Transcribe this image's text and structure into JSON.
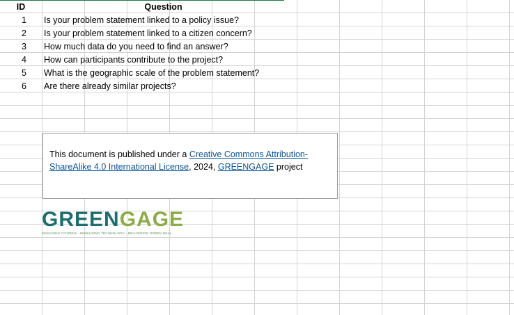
{
  "table": {
    "headers": {
      "id": "ID",
      "question": "Question"
    },
    "rows": [
      {
        "id": "1",
        "question": "Is your problem statement linked to a policy issue?"
      },
      {
        "id": "2",
        "question": "Is your problem statement linked to a citizen concern?"
      },
      {
        "id": "3",
        "question": "How much data do you need to find an answer?"
      },
      {
        "id": "4",
        "question": "How can participants contribute to the project?"
      },
      {
        "id": "5",
        "question": "What is the geographic scale of the problem statement?"
      },
      {
        "id": "6",
        "question": "Are there already similar projects?"
      }
    ]
  },
  "license": {
    "prefix": "This document is published under a ",
    "license_link": "Creative Commons Attribution-ShareAlike 4.0 International License",
    "middle": ", 2024, ",
    "project_link": "GREENGAGE",
    "suffix": " project"
  },
  "logo": {
    "word_part1": "GREEN",
    "word_part2": "GAGE",
    "tagline": "ENGAGING CITIZENS - MOBILIZING TECHNOLOGY - DELIVERING GREEN DEAL",
    "colors": {
      "primary": "#1f6d6c",
      "secondary": "#8dab48"
    }
  },
  "colors": {
    "grid": "#d4d4d4",
    "link": "#0b5394",
    "header_accent": "#217346"
  }
}
